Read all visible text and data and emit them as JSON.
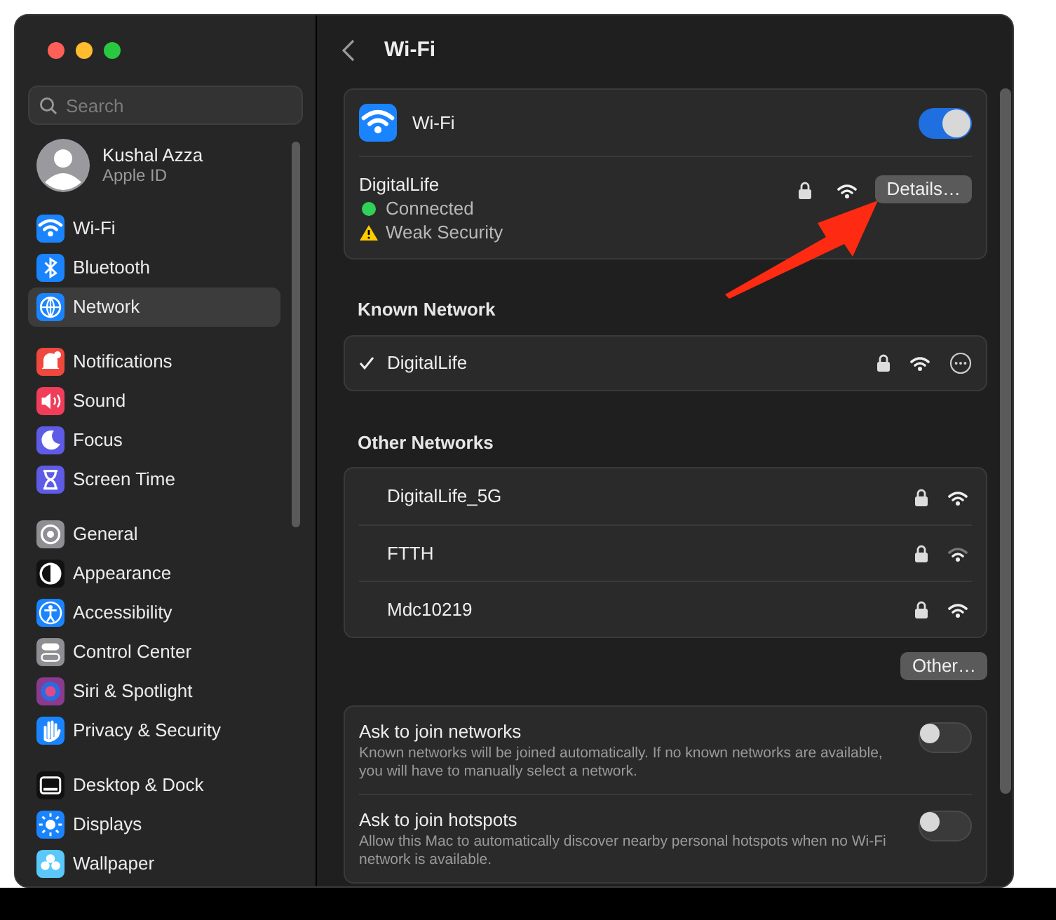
{
  "sidebar": {
    "search": {
      "placeholder": "Search"
    },
    "account": {
      "name": "Kushal Azza",
      "subtitle": "Apple ID"
    },
    "groups": [
      [
        {
          "label": "Wi-Fi",
          "color": "#1a84ff",
          "selected": false
        },
        {
          "label": "Bluetooth",
          "color": "#1a84ff",
          "selected": false
        },
        {
          "label": "Network",
          "color": "#1a84ff",
          "selected": true
        }
      ],
      [
        {
          "label": "Notifications",
          "color": "#f0483e",
          "selected": false
        },
        {
          "label": "Sound",
          "color": "#f03e5a",
          "selected": false
        },
        {
          "label": "Focus",
          "color": "#5e5ce6",
          "selected": false
        },
        {
          "label": "Screen Time",
          "color": "#5e5ce6",
          "selected": false
        }
      ],
      [
        {
          "label": "General",
          "color": "#8e8e93",
          "selected": false
        },
        {
          "label": "Appearance",
          "color": "#111111",
          "selected": false
        },
        {
          "label": "Accessibility",
          "color": "#1a84ff",
          "selected": false
        },
        {
          "label": "Control Center",
          "color": "#8e8e93",
          "selected": false
        },
        {
          "label": "Siri & Spotlight",
          "color": "#8a3a8f",
          "selected": false
        },
        {
          "label": "Privacy & Security",
          "color": "#1a84ff",
          "selected": false
        }
      ],
      [
        {
          "label": "Desktop & Dock",
          "color": "#111111",
          "selected": false
        },
        {
          "label": "Displays",
          "color": "#1a84ff",
          "selected": false
        },
        {
          "label": "Wallpaper",
          "color": "#5ac8fa",
          "selected": false
        }
      ]
    ]
  },
  "main": {
    "title": "Wi-Fi",
    "wifi_card": {
      "label": "Wi-Fi",
      "on": true,
      "current": {
        "name": "DigitalLife",
        "status": "Connected",
        "warning": "Weak Security",
        "button": "Details…"
      }
    },
    "known": {
      "heading": "Known Network",
      "items": [
        {
          "name": "DigitalLife",
          "selected": true
        }
      ]
    },
    "other": {
      "heading": "Other Networks",
      "items": [
        {
          "name": "DigitalLife_5G",
          "weak_signal": false
        },
        {
          "name": "FTTH",
          "weak_signal": true
        },
        {
          "name": "Mdc10219",
          "weak_signal": false
        }
      ],
      "button": "Other…"
    },
    "settings": [
      {
        "label": "Ask to join networks",
        "description": "Known networks will be joined automatically. If no known networks are available, you will have to manually select a network.",
        "on": false
      },
      {
        "label": "Ask to join hotspots",
        "description": "Allow this Mac to automatically discover nearby personal hotspots when no Wi-Fi network is available.",
        "on": false
      }
    ]
  }
}
